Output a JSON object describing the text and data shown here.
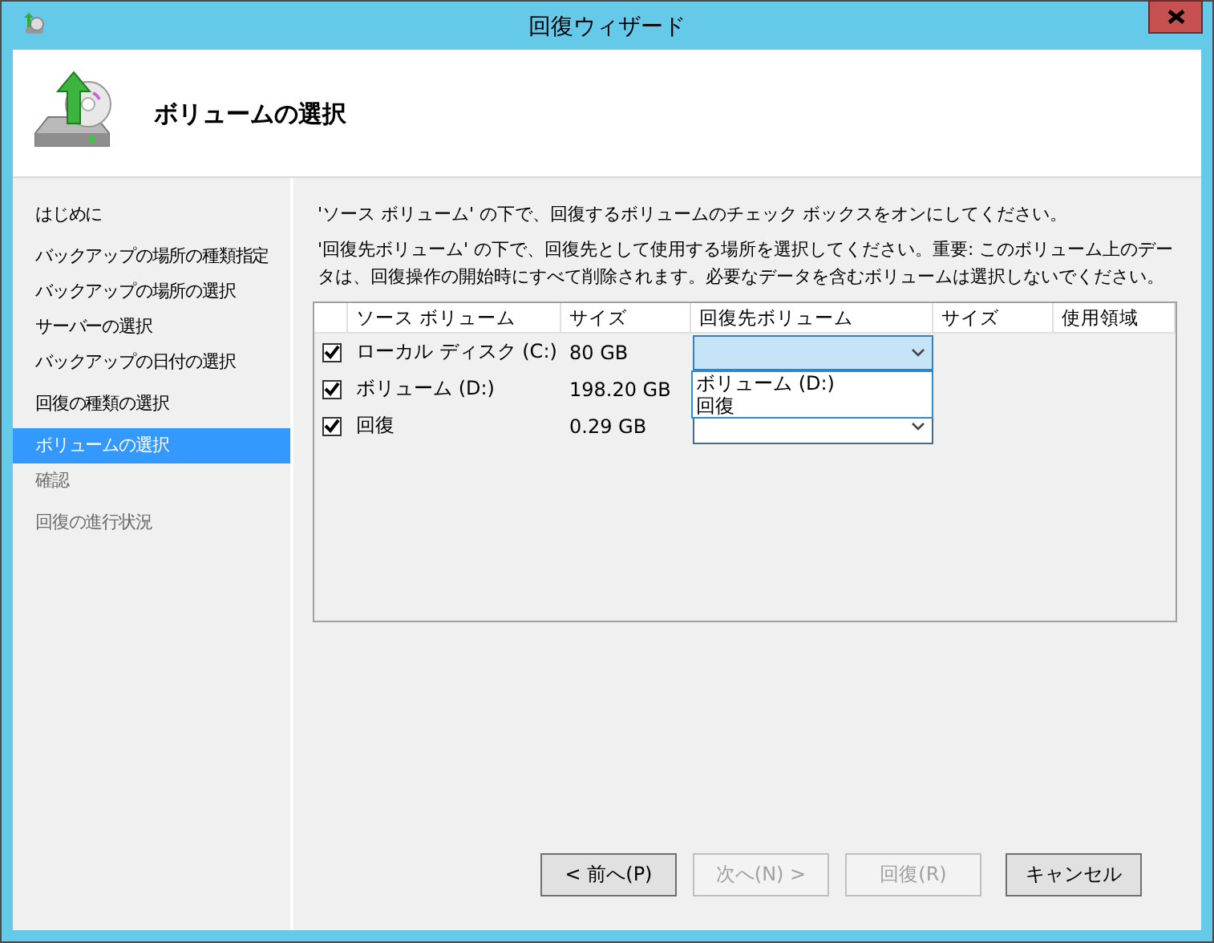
{
  "window": {
    "title": "回復ウィザード"
  },
  "header": {
    "title": "ボリュームの選択"
  },
  "sidebar": {
    "items": [
      {
        "label": "はじめに",
        "selected": false,
        "disabled": false
      },
      {
        "label": "バックアップの場所の種類指定",
        "selected": false,
        "disabled": false
      },
      {
        "label": "バックアップの場所の選択",
        "selected": false,
        "disabled": false
      },
      {
        "label": "サーバーの選択",
        "selected": false,
        "disabled": false
      },
      {
        "label": "バックアップの日付の選択",
        "selected": false,
        "disabled": false
      },
      {
        "label": "回復の種類の選択",
        "selected": false,
        "disabled": false
      },
      {
        "label": "ボリュームの選択",
        "selected": true,
        "disabled": false
      },
      {
        "label": "確認",
        "selected": false,
        "disabled": true
      },
      {
        "label": "回復の進行状況",
        "selected": false,
        "disabled": true
      }
    ]
  },
  "instructions": [
    "'ソース ボリューム' の下で、回復するボリュームのチェック ボックスをオンにしてください。",
    "'回復先ボリューム' の下で、回復先として使用する場所を選択してください。重要: このボリューム上のデータは、回復操作の開始時にすべて削除されます。必要なデータを含むボリュームは選択しないでください。"
  ],
  "table": {
    "columns": [
      "ソース ボリューム",
      "サイズ",
      "回復先ボリューム",
      "サイズ",
      "使用領域"
    ],
    "rows": [
      {
        "checked": true,
        "source": "ローカル ディスク (C:)",
        "size": "80 GB",
        "expanded": true,
        "options": [
          "ボリューム (D:)",
          "回復"
        ]
      },
      {
        "checked": true,
        "source": "ボリューム (D:)",
        "size": "198.20 GB"
      },
      {
        "checked": true,
        "source": "回復",
        "size": "0.29 GB",
        "expanded": false
      }
    ]
  },
  "buttons": [
    {
      "label": "< 前へ(P)",
      "disabled": false
    },
    {
      "label": "次へ(N) >",
      "disabled": true
    },
    {
      "label": "回復(R)",
      "disabled": true
    },
    {
      "label": "キャンセル",
      "disabled": false
    }
  ]
}
